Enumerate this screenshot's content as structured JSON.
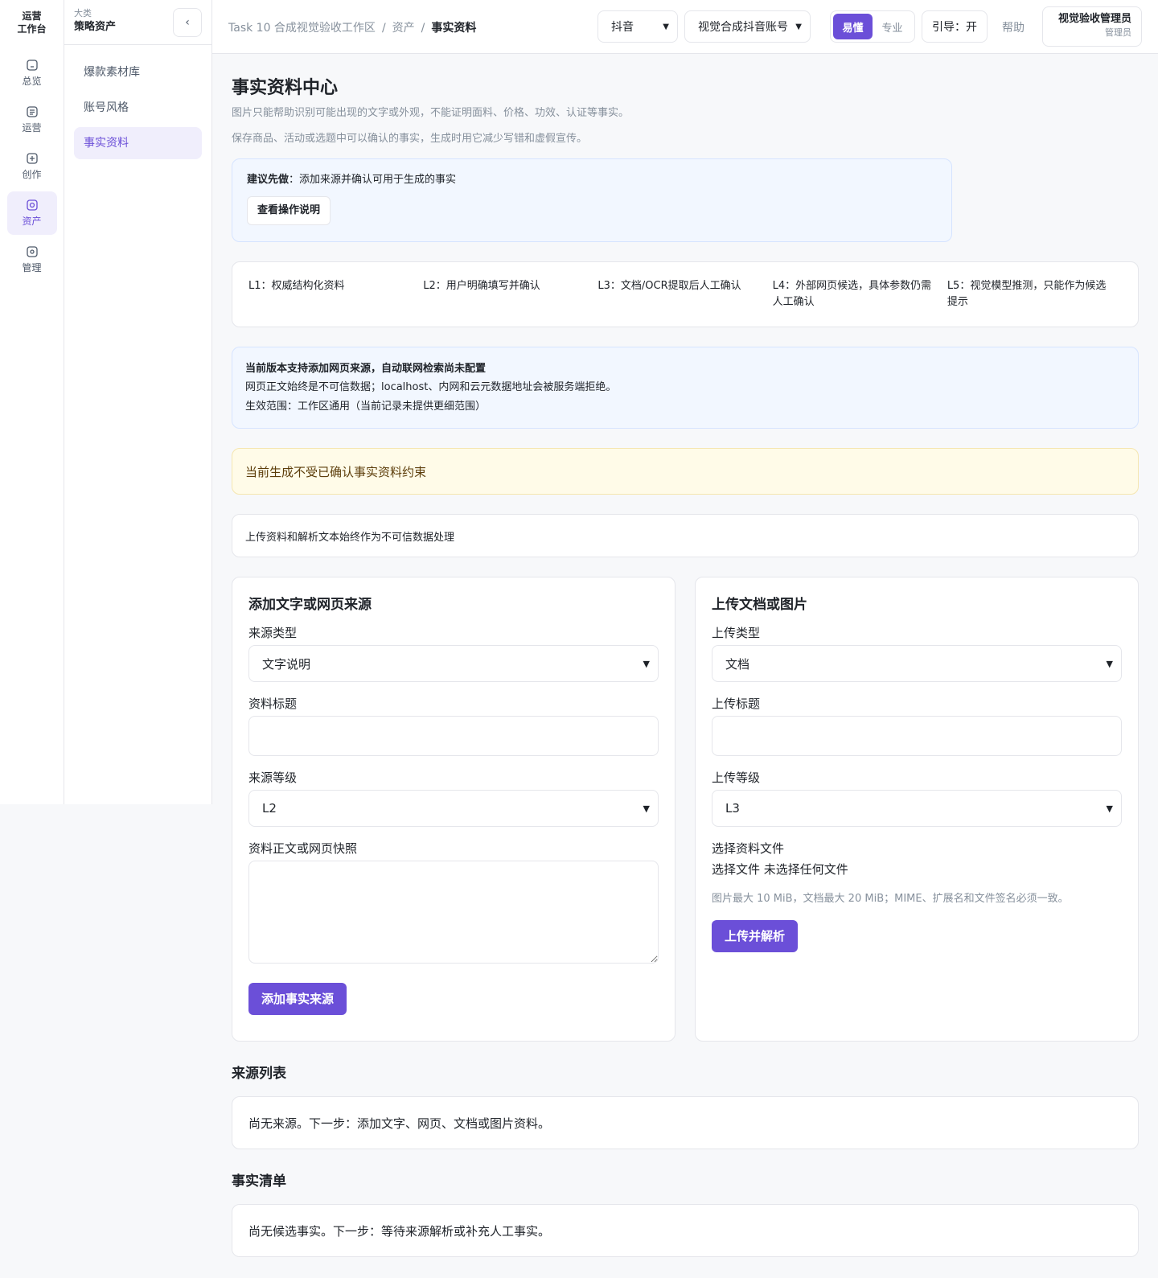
{
  "rail": {
    "title_line1": "运营",
    "title_line2": "工作台",
    "items": [
      {
        "label": "总览",
        "icon": "home-icon"
      },
      {
        "label": "运营",
        "icon": "list-icon"
      },
      {
        "label": "创作",
        "icon": "plus-square-icon"
      },
      {
        "label": "资产",
        "icon": "asset-icon"
      },
      {
        "label": "管理",
        "icon": "manage-icon"
      }
    ],
    "active": "资产"
  },
  "subnav": {
    "category_label": "大类",
    "group": "策略资产",
    "collapse_glyph": "‹",
    "items": [
      "爆款素材库",
      "账号风格",
      "事实资料"
    ],
    "active": "事实资料"
  },
  "topbar": {
    "breadcrumb": [
      "Task 10 合成视觉验收工作区",
      "资产",
      "事实资料"
    ],
    "platform_select": "抖音",
    "account_select": "视觉合成抖音账号",
    "mode": {
      "easy": "易懂",
      "pro": "专业",
      "active": "易懂"
    },
    "guide": "引导：开",
    "help": "帮助",
    "user_name": "视觉验收管理员",
    "user_role": "管理员"
  },
  "page": {
    "title": "事实资料中心",
    "desc1": "图片只能帮助识别可能出现的文字或外观，不能证明面料、价格、功效、认证等事实。",
    "desc2": "保存商品、活动或选题中可以确认的事实，生成时用它减少写错和虚假宣传。",
    "tip": {
      "prefix": "建议先做",
      "text": "：添加来源并确认可用于生成的事实",
      "button": "查看操作说明"
    },
    "levels": [
      "L1：权威结构化资料",
      "L2：用户明确填写并确认",
      "L3：文档/OCR提取后人工确认",
      "L4：外部网页候选，具体参数仍需人工确认",
      "L5：视觉模型推测，只能作为候选提示"
    ],
    "info": {
      "title": "当前版本支持添加网页来源，自动联网检索尚未配置",
      "line1": "网页正文始终是不可信数据；localhost、内网和云元数据地址会被服务端拒绝。",
      "line2": "生效范围：工作区通用（当前记录未提供更细范围）"
    },
    "warning": "当前生成不受已确认事实资料约束",
    "untrusted_note": "上传资料和解析文本始终作为不可信数据处理"
  },
  "text_form": {
    "title": "添加文字或网页来源",
    "source_type_label": "来源类型",
    "source_type_value": "文字说明",
    "title_label": "资料标题",
    "title_value": "",
    "level_label": "来源等级",
    "level_value": "L2",
    "body_label": "资料正文或网页快照",
    "body_value": "",
    "submit": "添加事实来源"
  },
  "upload_form": {
    "title": "上传文档或图片",
    "type_label": "上传类型",
    "type_value": "文档",
    "title_label": "上传标题",
    "title_value": "",
    "level_label": "上传等级",
    "level_value": "L3",
    "file_label": "选择资料文件",
    "file_button": "选择文件",
    "file_status": "未选择任何文件",
    "hint": "图片最大 10 MiB，文档最大 20 MiB；MIME、扩展名和文件签名必须一致。",
    "submit": "上传并解析"
  },
  "sources": {
    "title": "来源列表",
    "empty": "尚无来源。下一步：添加文字、网页、文档或图片资料。"
  },
  "facts": {
    "title": "事实清单",
    "empty": "尚无候选事实。下一步：等待来源解析或补充人工事实。"
  },
  "colors": {
    "accent": "#6b4fd8",
    "accent_soft": "#f0eefc",
    "info_bg": "#f2f7ff",
    "warn_bg": "#fffbe8"
  }
}
